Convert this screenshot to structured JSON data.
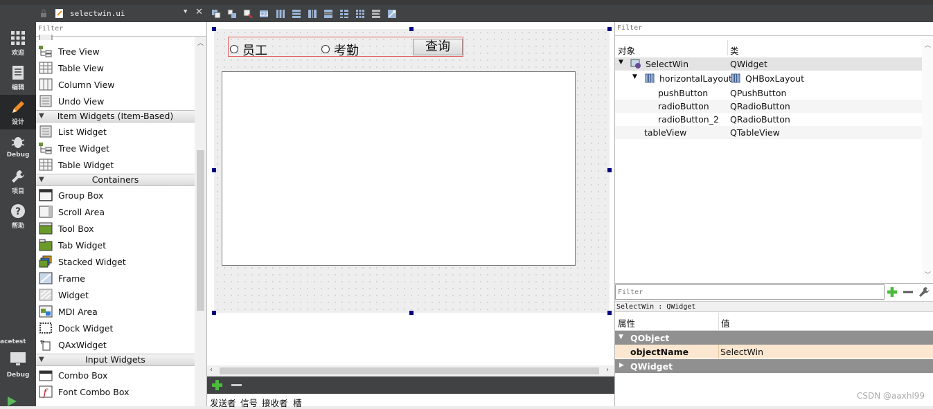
{
  "mode_bar": {
    "items": [
      {
        "label": "欢迎",
        "icon": "grid-icon"
      },
      {
        "label": "编辑",
        "icon": "edit-doc-icon"
      },
      {
        "label": "设计",
        "icon": "pencil-icon"
      },
      {
        "label": "Debug",
        "icon": "bug-icon"
      },
      {
        "label": "项目",
        "icon": "wrench-icon"
      },
      {
        "label": "帮助",
        "icon": "help-icon"
      }
    ],
    "kit_label": "acetest",
    "kit_mode": "Debug"
  },
  "editor_toolbar": {
    "file_name": "selectwin.ui",
    "close_label": "✕"
  },
  "widget_box": {
    "filter_placeholder": "Filter",
    "items": [
      {
        "label": "Tree View",
        "icon": "tree-view-icon"
      },
      {
        "label": "Table View",
        "icon": "table-view-icon"
      },
      {
        "label": "Column View",
        "icon": "column-view-icon"
      },
      {
        "label": "Undo View",
        "icon": "undo-view-icon"
      }
    ],
    "cat_item_widgets": "Item Widgets (Item-Based)",
    "item_widgets": [
      {
        "label": "List Widget",
        "icon": "list-widget-icon"
      },
      {
        "label": "Tree Widget",
        "icon": "tree-widget-icon"
      },
      {
        "label": "Table Widget",
        "icon": "table-widget-icon"
      }
    ],
    "cat_containers": "Containers",
    "containers": [
      {
        "label": "Group Box",
        "icon": "group-box-icon"
      },
      {
        "label": "Scroll Area",
        "icon": "scroll-area-icon"
      },
      {
        "label": "Tool Box",
        "icon": "tool-box-icon"
      },
      {
        "label": "Tab Widget",
        "icon": "tab-widget-icon"
      },
      {
        "label": "Stacked Widget",
        "icon": "stacked-widget-icon"
      },
      {
        "label": "Frame",
        "icon": "frame-icon"
      },
      {
        "label": "Widget",
        "icon": "widget-icon"
      },
      {
        "label": "MDI Area",
        "icon": "mdi-area-icon"
      },
      {
        "label": "Dock Widget",
        "icon": "dock-widget-icon"
      },
      {
        "label": "QAxWidget",
        "icon": "qaxwidget-icon"
      }
    ],
    "cat_input_widgets": "Input Widgets",
    "input_widgets": [
      {
        "label": "Combo Box",
        "icon": "combo-box-icon"
      },
      {
        "label": "Font Combo Box",
        "icon": "font-combo-box-icon"
      }
    ]
  },
  "form": {
    "radio_1": "员工",
    "radio_2": "考勤",
    "push_button": "查询"
  },
  "signal_slot": {
    "headers": [
      "发送者",
      "信号",
      "接收者",
      "槽"
    ]
  },
  "object_inspector": {
    "filter_placeholder": "Filter",
    "col_object": "对象",
    "col_class": "类",
    "rows": [
      {
        "name": "SelectWin",
        "cls": "QWidget"
      },
      {
        "name": "horizontalLayout",
        "cls": "QHBoxLayout"
      },
      {
        "name": "pushButton",
        "cls": "QPushButton"
      },
      {
        "name": "radioButton",
        "cls": "QRadioButton"
      },
      {
        "name": "radioButton_2",
        "cls": "QRadioButton"
      },
      {
        "name": "tableView",
        "cls": "QTableView"
      }
    ]
  },
  "property_editor": {
    "filter_placeholder": "Filter",
    "title": "SelectWin : QWidget",
    "col_property": "属性",
    "col_value": "值",
    "group_1": "QObject",
    "prop_name": "objectName",
    "prop_value": "SelectWin",
    "group_2": "QWidget"
  },
  "watermark": "CSDN @aaxhl99",
  "colors": {
    "dark_bar": "#404244",
    "selection_handle": "#000080",
    "layout_outline": "#e36060",
    "group_header": "#909090",
    "prop_highlight": "#fbe6cf"
  }
}
